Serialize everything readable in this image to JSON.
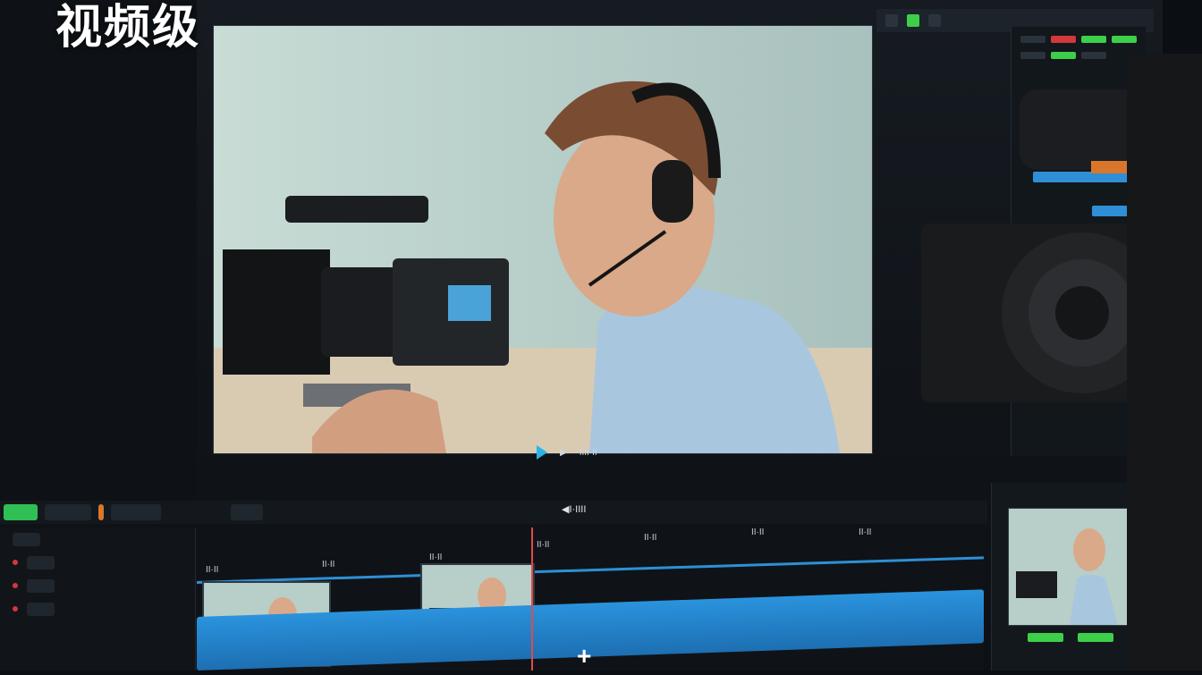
{
  "overlay": {
    "title": "视频级"
  },
  "viewer": {
    "timecode": "IIII·II"
  },
  "timeline": {
    "center_label": "◀I·IIII",
    "ruler_ticks": [
      "II·II",
      "II·II",
      "II·II",
      "II·II",
      "II·II",
      "II·II",
      "II·II"
    ]
  },
  "colors": {
    "accent": "#2e8fd6",
    "record": "#d3383a",
    "status": "#3ecf4a"
  },
  "icons": [
    "play-icon",
    "cursor-icon",
    "plus-icon"
  ]
}
